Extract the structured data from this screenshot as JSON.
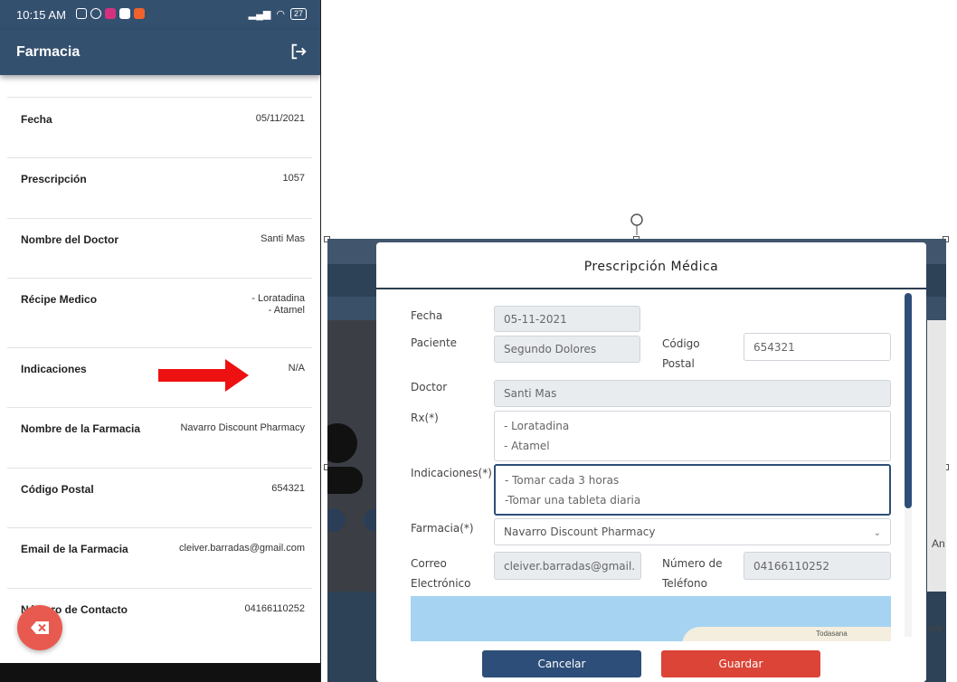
{
  "phone": {
    "status": {
      "time": "10:15 AM",
      "battery": "27"
    },
    "header": {
      "title": "Farmacia"
    },
    "rows": [
      {
        "label": "Fecha",
        "value": "05/11/2021"
      },
      {
        "label": "Prescripción",
        "value": "1057"
      },
      {
        "label": "Nombre del Doctor",
        "value": "Santi Mas"
      },
      {
        "label": "Récipe Medico",
        "value": "- Loratadina\n- Atamel"
      },
      {
        "label": "Indicaciones",
        "value": "N/A"
      },
      {
        "label": "Nombre de la Farmacia",
        "value": "Navarro Discount Pharmacy"
      },
      {
        "label": "Código Postal",
        "value": "654321"
      },
      {
        "label": "Email de la Farmacia",
        "value": "cleiver.barradas@gmail.com"
      },
      {
        "label": "Número de Contacto",
        "value": "04166110252"
      }
    ],
    "colors": {
      "header": "#34506f",
      "arrow": "#ee1111",
      "fab": "#e85a4f"
    }
  },
  "modal": {
    "title": "Prescripción Médica",
    "fecha": {
      "label": "Fecha",
      "value": "05-11-2021"
    },
    "paciente": {
      "label": "Paciente",
      "value": "Segundo Dolores"
    },
    "codigo_postal": {
      "label": "Código Postal",
      "value": "654321"
    },
    "doctor": {
      "label": "Doctor",
      "value": "Santi Mas"
    },
    "rx": {
      "label": "Rx(*)",
      "lines": [
        "- Loratadina",
        "- Atamel"
      ]
    },
    "indicaciones": {
      "label": "Indicaciones(*)",
      "lines": [
        "- Tomar cada 3 horas",
        "-Tomar una tableta diaria"
      ]
    },
    "farmacia": {
      "label": "Farmacia(*)",
      "value": "Navarro Discount Pharmacy"
    },
    "correo": {
      "label": "Correo Electrónico",
      "value": "cleiver.barradas@gmail."
    },
    "telefono": {
      "label": "Número de Teléfono",
      "value": "04166110252"
    },
    "map_label": "Todasana",
    "buttons": {
      "cancel": "Cancelar",
      "save": "Guardar"
    },
    "colors": {
      "primary": "#2d4e79",
      "danger": "#db4437",
      "disabled": "#e9ecef",
      "map_water": "#a6d3f2"
    }
  },
  "background": {
    "right_text1": "An",
    "right_text2": "uar"
  }
}
